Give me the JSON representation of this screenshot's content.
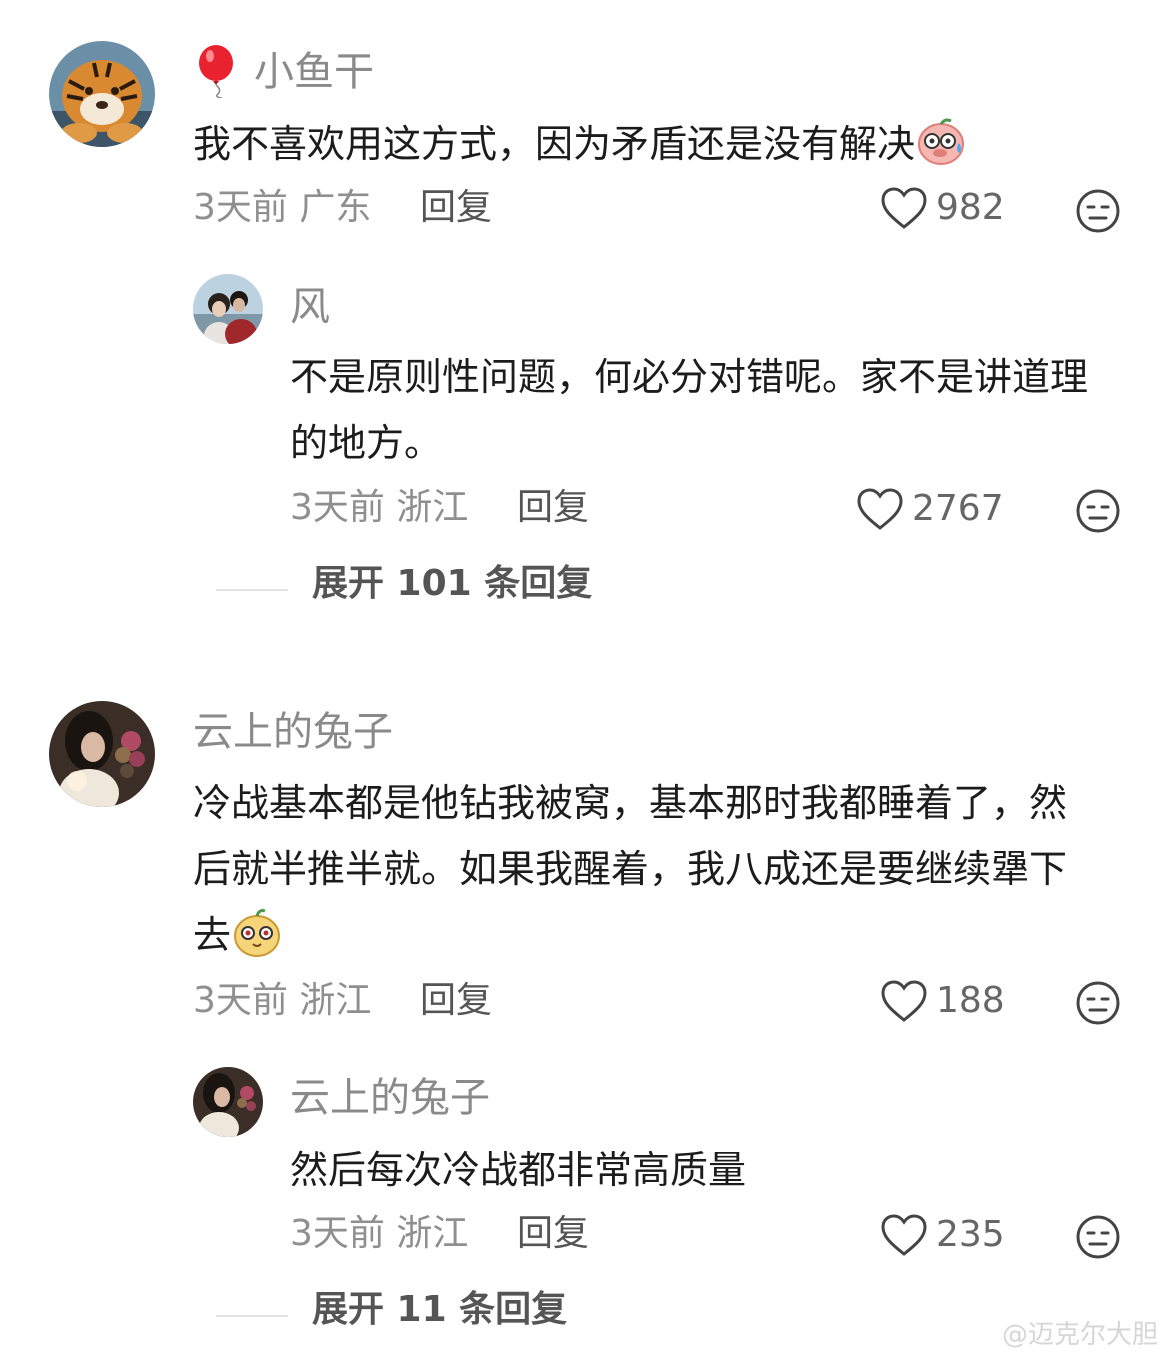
{
  "comments": [
    {
      "name": "小鱼干",
      "text": "我不喜欢用这方式，因为矛盾还是没有解决",
      "time": "3天前",
      "location": "广东",
      "reply_label": "回复",
      "likes": "982",
      "avatar_icon": "tiger-avatar",
      "badge_icon": "balloon-icon",
      "emoji_icon": "pig-sweat-emoji",
      "replies": [
        {
          "name": "风",
          "text": "不是原则性问题，何必分对错呢。家不是讲道理的地方。",
          "time": "3天前",
          "location": "浙江",
          "reply_label": "回复",
          "likes": "2767",
          "avatar_icon": "couple-photo-avatar"
        }
      ],
      "expand_label": "展开 101 条回复"
    },
    {
      "name": "云上的兔子",
      "text": "冷战基本都是他钻我被窝，基本那时我都睡着了，然后就半推半就。如果我醒着，我八成还是要继续犟下去",
      "time": "3天前",
      "location": "浙江",
      "reply_label": "回复",
      "likes": "188",
      "avatar_icon": "woman-flowers-avatar",
      "emoji_icon": "yellow-face-emoji",
      "replies": [
        {
          "name": "云上的兔子",
          "text": "然后每次冷战都非常高质量",
          "time": "3天前",
          "location": "浙江",
          "reply_label": "回复",
          "likes": "235",
          "avatar_icon": "woman-flowers-avatar"
        }
      ],
      "expand_label": "展开 11 条回复"
    }
  ],
  "colors": {
    "name": "#8a8a8a",
    "text": "#1c1c1c",
    "meta": "#8f8f8f",
    "divider": "#e3e3e3"
  },
  "watermark_text": "@迈克尔大胆"
}
